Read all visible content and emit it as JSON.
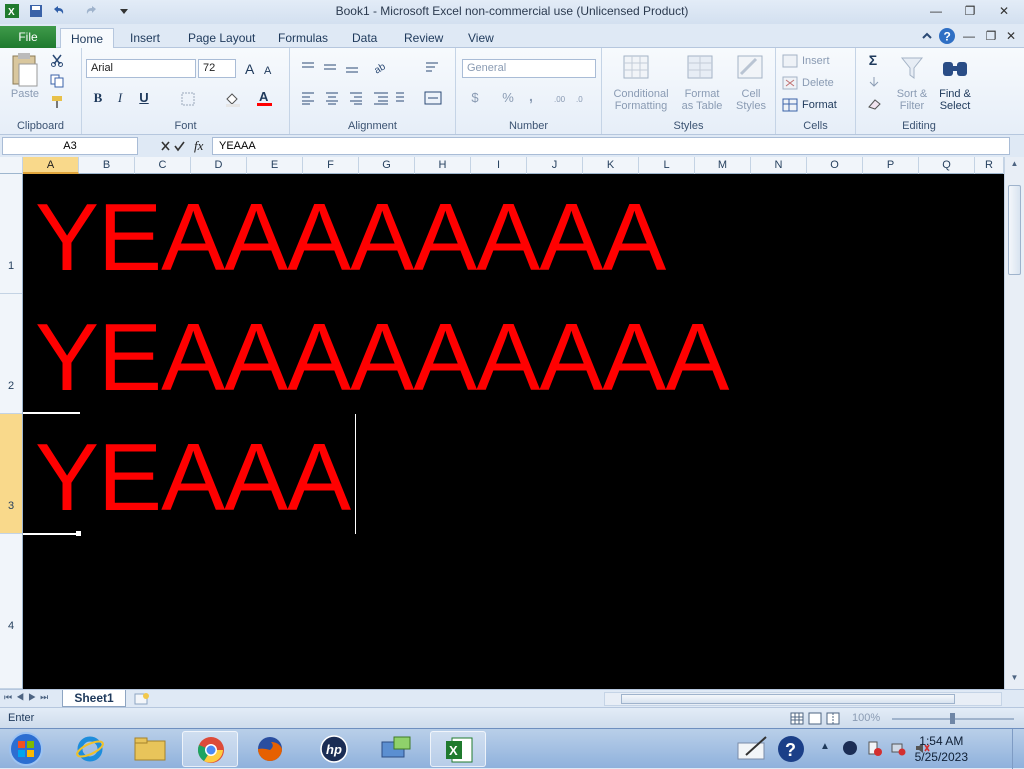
{
  "window": {
    "title": "Book1  -  Microsoft Excel non-commercial use (Unlicensed Product)"
  },
  "tabs": [
    "File",
    "Home",
    "Insert",
    "Page Layout",
    "Formulas",
    "Data",
    "Review",
    "View"
  ],
  "ribbon": {
    "clipboard": {
      "paste": "Paste",
      "label": "Clipboard"
    },
    "font": {
      "name": "Arial",
      "size": "72",
      "bold": "B",
      "italic": "I",
      "underline": "U",
      "label": "Font"
    },
    "alignment": {
      "label": "Alignment"
    },
    "number": {
      "format": "General",
      "currency": "$",
      "percent": "%",
      "comma": ",",
      "label": "Number"
    },
    "styles": {
      "conditional": "Conditional",
      "formatting": "Formatting",
      "format_as": "Format",
      "as_table": "as Table",
      "cell": "Cell",
      "styles_word": "Styles",
      "label": "Styles"
    },
    "cells": {
      "insert": "Insert",
      "delete": "Delete",
      "format": "Format",
      "label": "Cells"
    },
    "editing": {
      "sort": "Sort &",
      "filter": "Filter",
      "find": "Find &",
      "select": "Select",
      "label": "Editing"
    }
  },
  "formula_bar": {
    "name_box": "A3",
    "fx": "fx",
    "content": "YEAAA"
  },
  "columns": [
    "A",
    "B",
    "C",
    "D",
    "E",
    "F",
    "G",
    "H",
    "I",
    "J",
    "K",
    "L",
    "M",
    "N",
    "O",
    "P",
    "Q",
    "R"
  ],
  "rows": [
    "1",
    "2",
    "3",
    "4"
  ],
  "cells": [
    {
      "ref": "A1",
      "text": "YEAAAAAAAA"
    },
    {
      "ref": "A2",
      "text": "YEAAAAAAAAA"
    },
    {
      "ref": "A3",
      "text": "YEAAA"
    }
  ],
  "sheet_tab": "Sheet1",
  "status": {
    "mode": "Enter",
    "zoom": "100%"
  },
  "clock": {
    "time": "1:54 AM",
    "date": "5/25/2023"
  },
  "colors": {
    "cell_background": "#000000",
    "cell_text": "#ff0000",
    "excel_green": "#1f7a2e"
  }
}
